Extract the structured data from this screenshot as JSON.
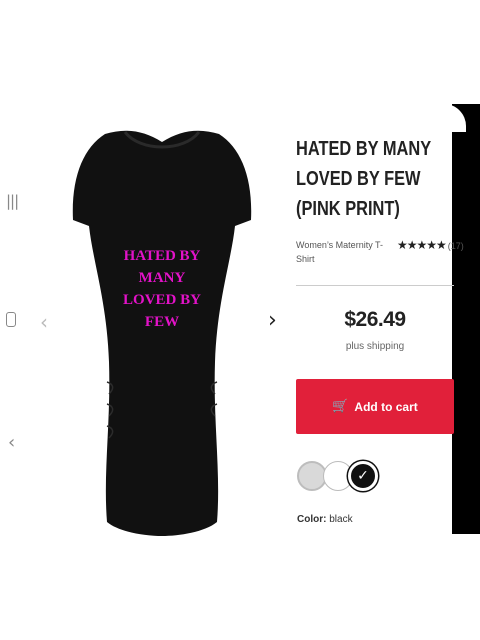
{
  "system_nav": {
    "recent_glyph": "|||",
    "back_glyph": "‹"
  },
  "carousel": {
    "prev_glyph": "‹",
    "next_glyph": "›"
  },
  "product": {
    "image_text_lines": [
      "HATED BY",
      "MANY",
      "LOVED BY",
      "FEW"
    ],
    "image_text_color": "#e312c8",
    "shirt_color": "#111111",
    "title": "HATED BY MANY LOVED BY FEW (PINK PRINT)",
    "subtitle": "Women’s Maternity T-Shirt",
    "rating_stars": "★★★★★",
    "rating_count": "(17)",
    "price": "$26.49",
    "shipping_note": "plus shipping"
  },
  "cart": {
    "button_label": "Add to cart",
    "cart_icon_glyph": "🛒",
    "accent_color": "#e1203a"
  },
  "colors": {
    "swatches": [
      "light grey",
      "white",
      "black"
    ],
    "selected_index": 2,
    "check_glyph": "✓",
    "label_prefix": "Color:",
    "selected_color": "black"
  }
}
